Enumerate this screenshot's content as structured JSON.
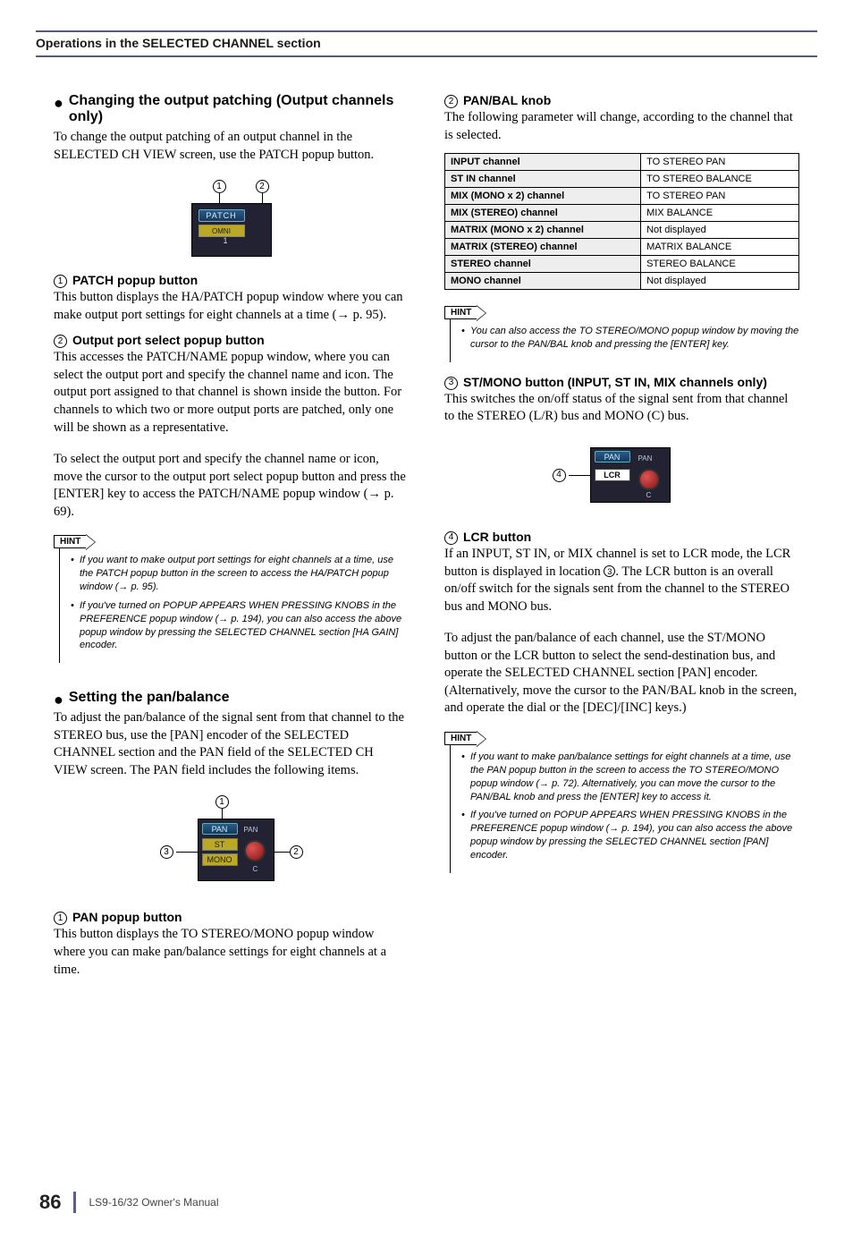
{
  "header": {
    "title": "Operations in the SELECTED CHANNEL section"
  },
  "left": {
    "sec1_title": "Changing the output patching (Output channels only)",
    "sec1_body": "To change the output patching of an output channel in the SELECTED CH VIEW screen, use the PATCH popup button.",
    "fig_patch": {
      "patch": "PATCH",
      "port": "OMNI",
      "num": "1"
    },
    "item1_title": "PATCH popup button",
    "item1_body": "This button displays the HA/PATCH popup window where you can make output port settings for eight channels at a time (→ p. 95).",
    "item2_title": "Output port select popup button",
    "item2_body": "This accesses the PATCH/NAME popup window, where you can select the output port and specify the channel name and icon. The output port assigned to that channel is shown inside the button. For channels to which two or more output ports are patched, only one will be shown as a representative.",
    "para2": "To select the output port and specify the channel name or icon, move the cursor to the output port select popup button and press the [ENTER] key to access the PATCH/NAME popup window (→ p. 69).",
    "hint1": {
      "label": "HINT",
      "a": "If you want to make output port settings for eight channels at a time, use the PATCH popup button in the screen to access the HA/PATCH popup window (→ p. 95).",
      "b": "If you've turned on POPUP APPEARS WHEN PRESSING KNOBS in the PREFERENCE popup window (→ p. 194), you can also access the above popup window by pressing the SELECTED CHANNEL section [HA GAIN] encoder."
    },
    "sec2_title": "Setting the pan/balance",
    "sec2_body": "To adjust the pan/balance of the signal sent from that channel to the STEREO bus, use the [PAN] encoder of the SELECTED CHANNEL section and the PAN field of the SELECTED CH VIEW screen. The PAN field includes the following items.",
    "fig_pan": {
      "pan": "PAN",
      "label": "PAN",
      "st": "ST",
      "mono": "MONO",
      "c": "C"
    },
    "item_pan1_title": "PAN popup button",
    "item_pan1_body": "This button displays the TO STEREO/MONO popup window where you can make pan/balance settings for eight channels at a time."
  },
  "right": {
    "item2_title": "PAN/BAL knob",
    "item2_body": "The following parameter will change, according to the channel that is selected.",
    "table": [
      [
        "INPUT channel",
        "TO STEREO PAN"
      ],
      [
        "ST IN channel",
        "TO STEREO BALANCE"
      ],
      [
        "MIX (MONO x 2) channel",
        "TO STEREO PAN"
      ],
      [
        "MIX (STEREO) channel",
        "MIX BALANCE"
      ],
      [
        "MATRIX (MONO x 2) channel",
        "Not displayed"
      ],
      [
        "MATRIX (STEREO) channel",
        "MATRIX BALANCE"
      ],
      [
        "STEREO channel",
        "STEREO BALANCE"
      ],
      [
        "MONO channel",
        "Not displayed"
      ]
    ],
    "hint2": {
      "label": "HINT",
      "a": "You can also access the TO STEREO/MONO popup window by moving the cursor to the PAN/BAL knob and pressing the [ENTER] key."
    },
    "item3_title": "ST/MONO button (INPUT, ST IN, MIX channels only)",
    "item3_body": "This switches the on/off status of the signal sent from that channel to the STEREO (L/R) bus and MONO (C) bus.",
    "fig_lcr": {
      "pan": "PAN",
      "label": "PAN",
      "lcr": "LCR",
      "c": "C"
    },
    "item4_title": "LCR button",
    "item4_body_a": "If an INPUT, ST IN, or MIX channel is set to LCR mode, the LCR button is displayed in location ",
    "item4_body_b": ". The LCR button is an overall on/off switch for the signals sent from the channel to the STEREO bus and MONO bus.",
    "para3": "To adjust the pan/balance of each channel, use the ST/MONO button or the LCR button to select the send-destination bus, and operate the SELECTED CHANNEL section [PAN] encoder. (Alternatively, move the cursor to the PAN/BAL knob in the screen, and operate the dial or the [DEC]/[INC] keys.)",
    "hint3": {
      "label": "HINT",
      "a": "If you want to make pan/balance settings for eight channels at a time, use the PAN popup button in the screen to access the TO STEREO/MONO popup window (→ p. 72). Alternatively, you can move the cursor to the PAN/BAL knob and press the [ENTER] key to access it.",
      "b": "If you've turned on POPUP APPEARS WHEN PRESSING KNOBS in the PREFERENCE popup window (→ p. 194), you can also access the above popup window by pressing the SELECTED CHANNEL section [PAN] encoder."
    }
  },
  "footer": {
    "page": "86",
    "text": "LS9-16/32  Owner's Manual"
  }
}
